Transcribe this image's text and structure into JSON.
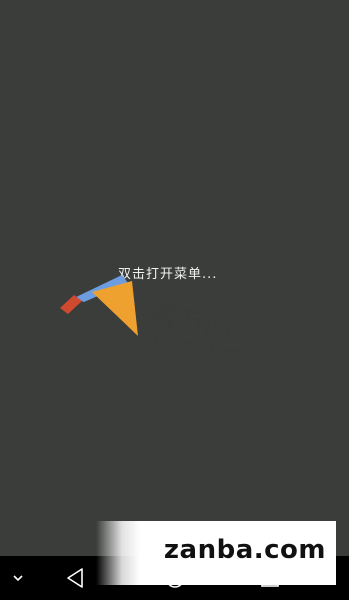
{
  "screen": {
    "hint": "双击打开菜单..."
  },
  "watermark": {
    "cn_text": "魔方网",
    "en_text": "mofang.com",
    "colors": {
      "blue": "#6d9de0",
      "orange": "#eea12f",
      "red": "#cf4a2e",
      "text": "#3b3b3b"
    }
  },
  "banner": {
    "text": "zanba.com"
  },
  "navbar": {
    "icons": [
      "collapse-chevron-icon",
      "back-icon",
      "home-icon",
      "recent-apps-icon"
    ]
  }
}
